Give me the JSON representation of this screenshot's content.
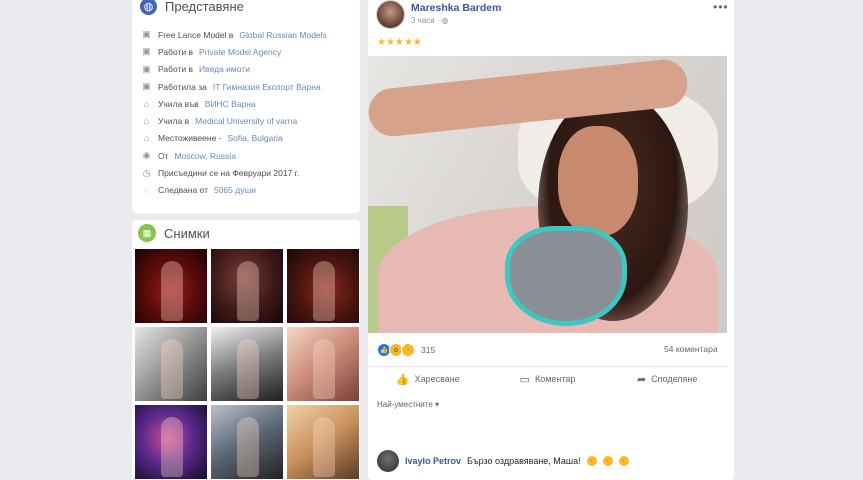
{
  "intro": {
    "title": "Представяне",
    "items": [
      {
        "icon": "briefcase-icon",
        "prefix": "Free Lance Model в ",
        "link": "Global Russian Models"
      },
      {
        "icon": "briefcase-icon",
        "prefix": "Работи в ",
        "link": "Private Model Agency"
      },
      {
        "icon": "briefcase-icon",
        "prefix": "Работи в ",
        "link": "Иведа имоти"
      },
      {
        "icon": "briefcase-icon",
        "prefix": "Работила за ",
        "link": "IT Гимназия Експорт Варна"
      },
      {
        "icon": "graduation-cap-icon",
        "prefix": "Учила във ",
        "link": "ВИНС Варна"
      },
      {
        "icon": "graduation-cap-icon",
        "prefix": "Учила в ",
        "link": "Medical University of varna"
      },
      {
        "icon": "home-icon",
        "prefix": "Местоживеене - ",
        "link": "Sofia, Bulgaria"
      },
      {
        "icon": "location-pin-icon",
        "prefix": "От ",
        "link": "Moscow, Russia"
      },
      {
        "icon": "clock-icon",
        "prefix": "Присъедини се на Февруари 2017 г.",
        "link": ""
      },
      {
        "icon": "follow-icon",
        "prefix": "Следвана от ",
        "link": "5065 души"
      }
    ]
  },
  "photos": {
    "title": "Снимки",
    "thumbs": [
      "photo-thumb-1",
      "photo-thumb-2",
      "photo-thumb-3",
      "photo-thumb-4",
      "photo-thumb-5",
      "photo-thumb-6",
      "photo-thumb-7",
      "photo-thumb-8",
      "photo-thumb-9"
    ]
  },
  "post": {
    "author": "Mareshka Bardem",
    "time": "3 часа",
    "privacy_icon": "globe-icon",
    "stars": "★★★★★",
    "reactions": {
      "count": "315",
      "types": [
        "like",
        "wow",
        "sad"
      ]
    },
    "comments_count": "54 коментара",
    "actions": {
      "like": "Харесване",
      "comment": "Коментар",
      "share": "Споделяне"
    },
    "sort_label": "Най-уместните",
    "comment": {
      "author": "Ivaylo Petrov",
      "text": "Бързо оздравяване, Маша!"
    }
  },
  "colors": {
    "link": "#385898",
    "accent": "#4267b2",
    "background": "#e9ebee"
  }
}
